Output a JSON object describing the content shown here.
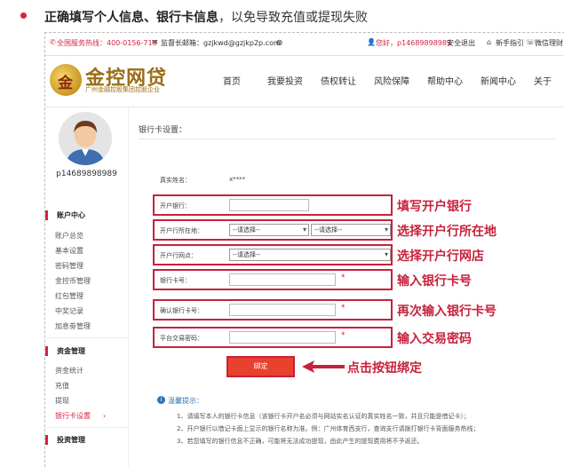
{
  "intro": {
    "bold": "正确填写个人信息、银行卡信息",
    "rest": "，以免导致充值或提现失败"
  },
  "topbar": {
    "hotline": "全国服务热线：400-0156-718",
    "email": "监督长邮箱：gzjkwd@gzjkp2p.com",
    "greeting": "您好，p14689898989",
    "logout": "安全退出",
    "guide": "新手指引",
    "wechat": "微信理财"
  },
  "brand": {
    "name": "金控网贷",
    "subtitle": "广州金融控股集团控股企业"
  },
  "nav": [
    "首页",
    "我要投资",
    "债权转让",
    "风险保障",
    "帮助中心",
    "新闻中心",
    "关于"
  ],
  "user": {
    "username": "p14689898989"
  },
  "sidebar": {
    "account_title": "账户中心",
    "account_items": [
      "账户总览",
      "基本设置",
      "密码管理",
      "金控币管理",
      "红包管理",
      "中奖记录",
      "加息劵管理"
    ],
    "funds_title": "资金管理",
    "funds_items": [
      "资金统计",
      "充值",
      "提现",
      "银行卡设置"
    ],
    "invest_title": "投资管理"
  },
  "form": {
    "title": "银行卡设置：",
    "name_label": "真实姓名：",
    "name_value": "x****",
    "bank_label": "开户银行：",
    "location_label": "开户行所在地：",
    "province_placeholder": "--请选择--",
    "city_placeholder": "--请选择--",
    "branch_label": "开户行网点：",
    "branch_placeholder": "--请选择--",
    "card_label": "银行卡号：",
    "confirm_label": "确认银行卡号：",
    "password_label": "平台交易密码：",
    "required": "*",
    "submit": "绑定"
  },
  "annotations": {
    "bank": "填写开户银行",
    "location": "选择开户行所在地",
    "branch": "选择开户行网店",
    "card": "输入银行卡号",
    "confirm": "再次输入银行卡号",
    "password": "输入交易密码",
    "submit": "点击按钮绑定"
  },
  "tips": {
    "title": "温馨提示：",
    "lines": [
      "1、请填写本人的银行卡信息（该银行卡开户名必须与网站实名认证的真实姓名一致，并且只能是借记卡）；",
      "2、开户银行以借记卡面上显示的银行名称为准。例：广州体育西支行，查询支行请拨打银行卡背面服务热线；",
      "3、若您填写的银行信息不正确，可能将无法成功提现，由此产生的提现费用将不予返还。"
    ]
  },
  "colors": {
    "accent": "#d6243d",
    "annotation": "#c8213c",
    "button": "#e8412e",
    "tip": "#2e74b5",
    "brand": "#9a6d16"
  }
}
